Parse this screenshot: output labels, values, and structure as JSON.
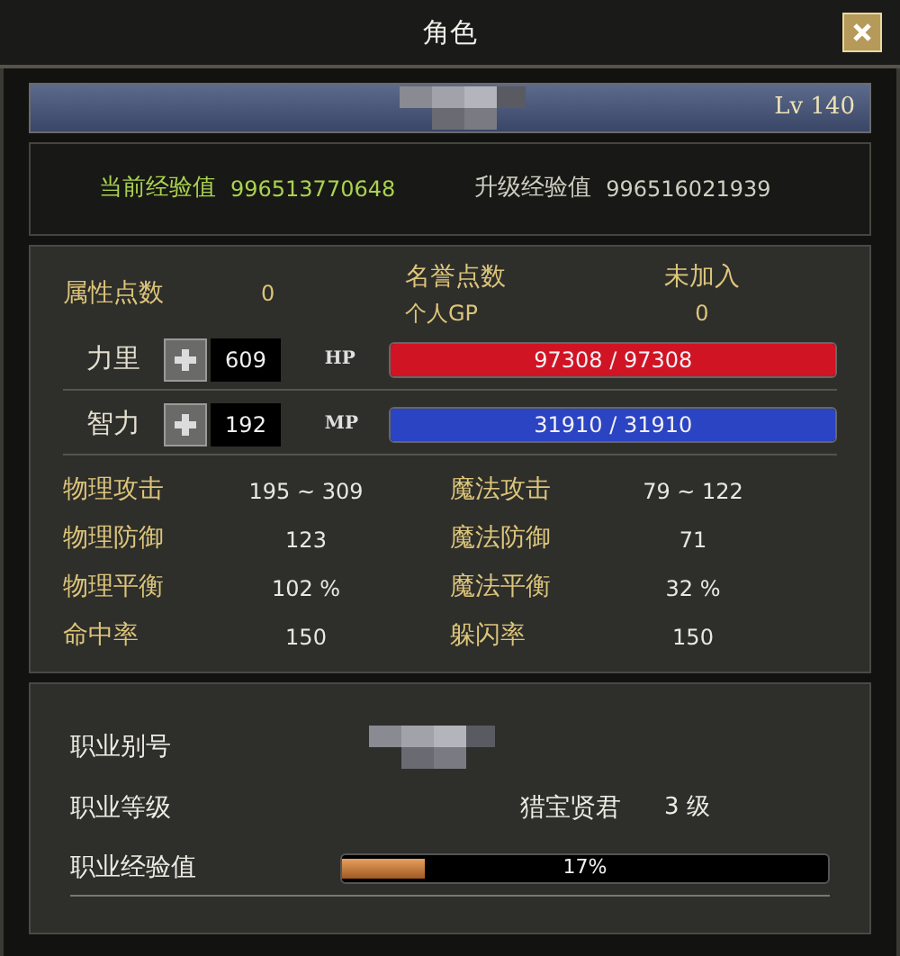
{
  "window": {
    "title": "角色"
  },
  "header": {
    "level": "Lv 140"
  },
  "experience": {
    "current_label": "当前经验值",
    "current": "996513770648",
    "next_label": "升级经验值",
    "next": "996516021939"
  },
  "points": {
    "attribute_label": "属性点数",
    "attribute": "0",
    "honor_label": "名誉点数",
    "honor": "未加入",
    "gp_label": "个人GP",
    "gp": "0"
  },
  "attributes": [
    {
      "label": "力里",
      "value": "609",
      "bar_label": "HP",
      "reading": "97308 / 97308",
      "level": 1,
      "color": "#d01424"
    },
    {
      "label": "智力",
      "value": "192",
      "bar_label": "MP",
      "reading": "31910 / 31910",
      "level": 1,
      "color": "#2a44c4"
    }
  ],
  "stats_left": [
    {
      "label": "物理攻击",
      "value": "195 ~ 309"
    },
    {
      "label": "物理防御",
      "value": "123"
    },
    {
      "label": "物理平衡",
      "value": "102 %"
    },
    {
      "label": "命中率",
      "value": "150"
    }
  ],
  "stats_right": [
    {
      "label": "魔法攻击",
      "value": "79 ~ 122"
    },
    {
      "label": "魔法防御",
      "value": "71"
    },
    {
      "label": "魔法平衡",
      "value": "32 %"
    },
    {
      "label": "躲闪率",
      "value": "150"
    }
  ],
  "job": {
    "alias_label": "职业别号",
    "rank_label": "职业等级",
    "rank_title": "猎宝贤君",
    "rank": "3 级",
    "exp_label": "职业经验值",
    "level": 0.17,
    "reading": "17%"
  }
}
